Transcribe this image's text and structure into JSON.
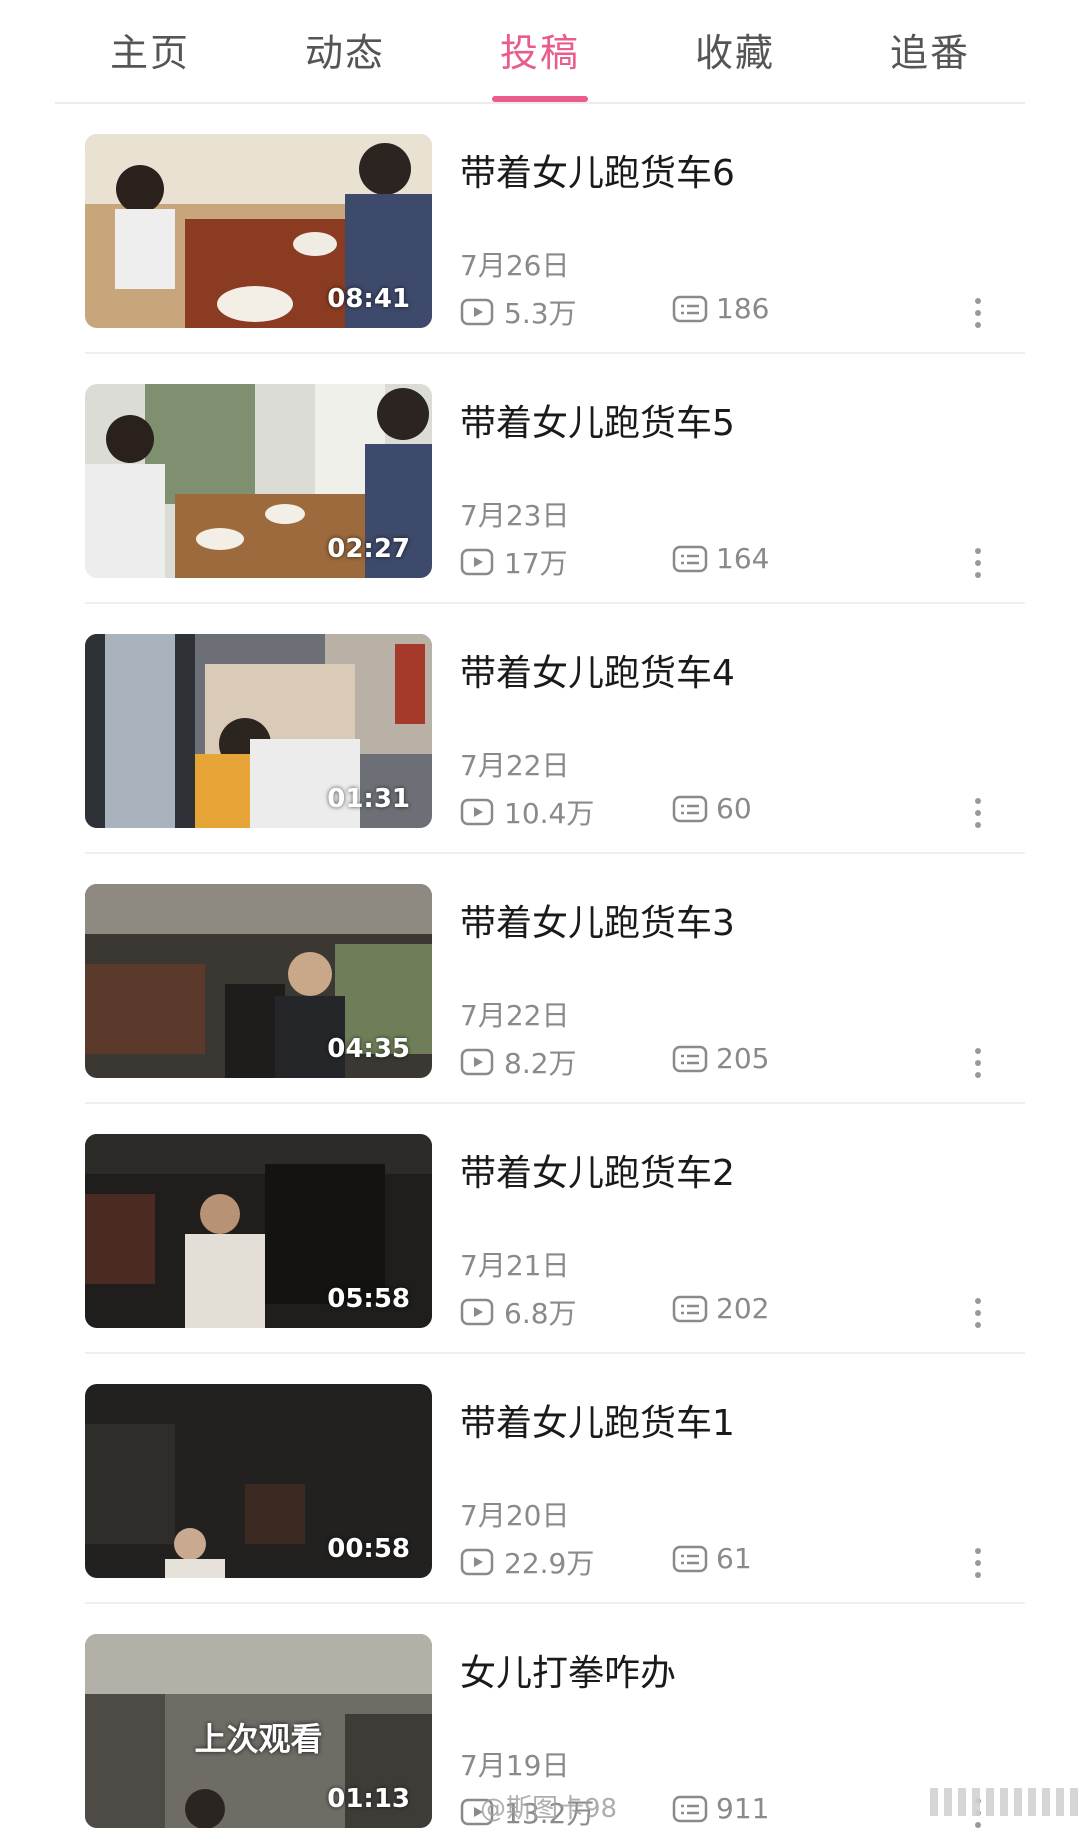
{
  "tabs": [
    {
      "label": "主页"
    },
    {
      "label": "动态"
    },
    {
      "label": "投稿"
    },
    {
      "label": "收藏"
    },
    {
      "label": "追番"
    }
  ],
  "active_tab": "投稿",
  "accent_color": "#ea5c8a",
  "videos": [
    {
      "title": "带着女儿跑货车6",
      "date": "7月26日",
      "views": "5.3万",
      "comments": "186",
      "duration": "08:41"
    },
    {
      "title": "带着女儿跑货车5",
      "date": "7月23日",
      "views": "17万",
      "comments": "164",
      "duration": "02:27"
    },
    {
      "title": "带着女儿跑货车4",
      "date": "7月22日",
      "views": "10.4万",
      "comments": "60",
      "duration": "01:31"
    },
    {
      "title": "带着女儿跑货车3",
      "date": "7月22日",
      "views": "8.2万",
      "comments": "205",
      "duration": "04:35"
    },
    {
      "title": "带着女儿跑货车2",
      "date": "7月21日",
      "views": "6.8万",
      "comments": "202",
      "duration": "05:58"
    },
    {
      "title": "带着女儿跑货车1",
      "date": "7月20日",
      "views": "22.9万",
      "comments": "61",
      "duration": "00:58"
    },
    {
      "title": "女儿打拳咋办",
      "date": "7月19日",
      "views": "13.2万",
      "comments": "911",
      "duration": "01:13",
      "badge": "上次观看"
    }
  ],
  "watermark": "@斯图卡98",
  "icons": {
    "play": "play-count-icon",
    "comment": "comment-count-icon",
    "more": "more-vertical-icon"
  }
}
